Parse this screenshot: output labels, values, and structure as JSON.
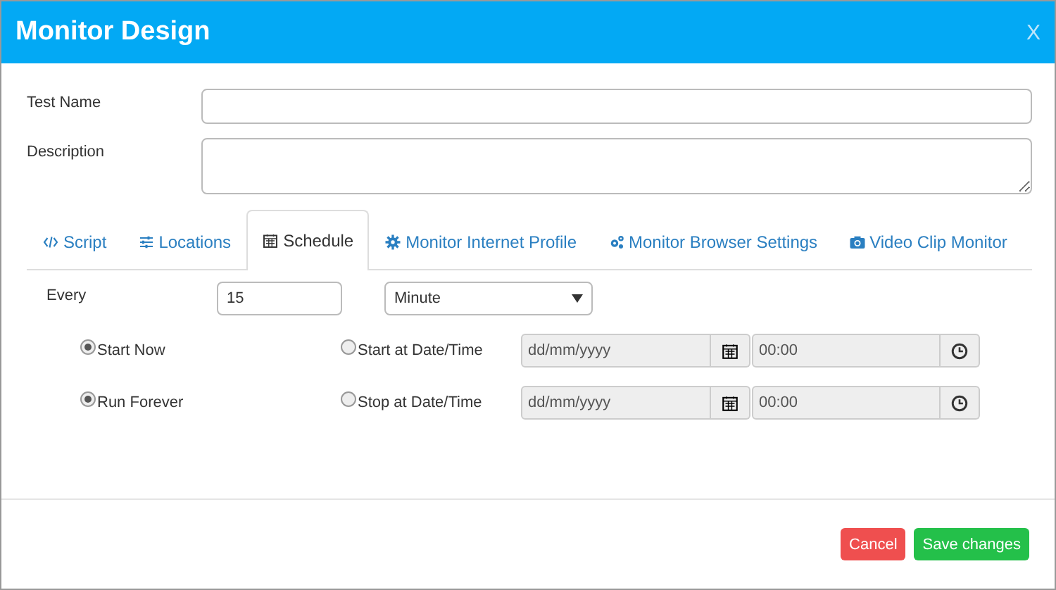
{
  "window": {
    "title": "Monitor Design",
    "close": "X"
  },
  "fields": [
    {
      "label": "Test Name",
      "kind": "input"
    },
    {
      "label": "Description",
      "kind": "textarea"
    }
  ],
  "tabs": [
    {
      "label": "Script",
      "selected": false
    },
    {
      "label": "Locations",
      "selected": false
    },
    {
      "label": "Schedule",
      "selected": true
    },
    {
      "label": "Monitor Internet Profile",
      "selected": false
    },
    {
      "label": "Monitor Browser Settings",
      "selected": false
    },
    {
      "label": "Video Clip Monitor",
      "selected": false
    }
  ],
  "schedule": {
    "every_label": "Every",
    "every_value": "15",
    "unit": "Minute",
    "rows": [
      {
        "options": [
          {
            "label": "Start Now",
            "selected": true
          },
          {
            "label": "Start at Date/Time",
            "selected": false
          }
        ],
        "date": {
          "placeholder": "dd/mm/yyyy",
          "disabled": true
        },
        "time": {
          "placeholder": "00:00",
          "disabled": true
        }
      },
      {
        "options": [
          {
            "label": "Run Forever",
            "selected": true
          },
          {
            "label": "Stop at Date/Time",
            "selected": false
          }
        ],
        "date": {
          "placeholder": "dd/mm/yyyy",
          "disabled": true
        },
        "time": {
          "placeholder": "00:00",
          "disabled": true
        }
      }
    ]
  },
  "buttons": [
    {
      "label": "Cancel",
      "kind": "danger"
    },
    {
      "label": "Save changes",
      "kind": "success"
    }
  ]
}
